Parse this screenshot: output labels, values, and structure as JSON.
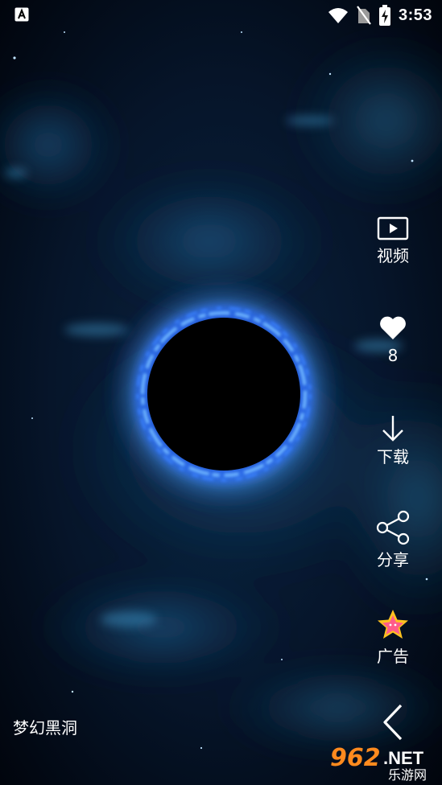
{
  "status_bar": {
    "time": "3:53",
    "icons": [
      "app-notification-icon",
      "wifi-icon",
      "no-sim-icon",
      "battery-charging-icon"
    ]
  },
  "wallpaper": {
    "title": "梦幻黑洞"
  },
  "actions": [
    {
      "name": "video",
      "icon": "play-video-icon",
      "label": "视频"
    },
    {
      "name": "like",
      "icon": "heart-icon",
      "label": "8"
    },
    {
      "name": "download",
      "icon": "download-arrow-icon",
      "label": "下载"
    },
    {
      "name": "share",
      "icon": "share-icon",
      "label": "分享"
    },
    {
      "name": "ad",
      "icon": "star-badge-icon",
      "label": "广告"
    }
  ],
  "navigation": {
    "back_icon": "chevron-left-icon"
  },
  "watermark": {
    "number": "962",
    "suffix": ".NET",
    "subtitle": "乐游网"
  },
  "colors": {
    "background": "#020814",
    "ring": "#3f8cff",
    "ring_glow": "#1e5cff",
    "nebula": "#1b4f7a",
    "watermark_orange": "#ff8a1e"
  }
}
